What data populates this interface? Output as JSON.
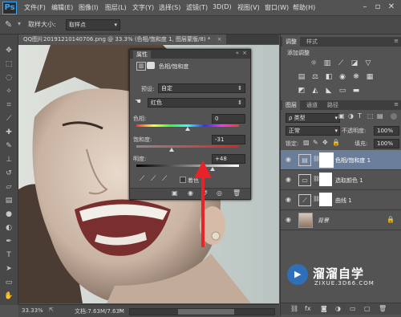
{
  "app": {
    "logo": "Ps"
  },
  "menu": [
    "文件(F)",
    "编辑(E)",
    "图像(I)",
    "图层(L)",
    "文字(Y)",
    "选择(S)",
    "滤镜(T)",
    "3D(D)",
    "视图(V)",
    "窗口(W)",
    "帮助(H)"
  ],
  "options_bar": {
    "sample_size_label": "取样大小:",
    "sample_size_value": "取样点"
  },
  "document": {
    "tab_title": "QQ图片20191210140706.png @ 33.3% (色相/饱和度 1, 图层蒙版/8) *",
    "zoom": "33.33%",
    "doc_info": "文档:7.63M/7.63M"
  },
  "properties": {
    "panel_title": "属性",
    "adjustment_name": "色相/饱和度",
    "preset_label": "预设:",
    "preset_value": "自定",
    "channel_value": "红色",
    "hue_label": "色相:",
    "hue_value": "0",
    "saturation_label": "饱和度:",
    "saturation_value": "-31",
    "lightness_label": "明度:",
    "lightness_value": "+48",
    "colorize_label": "着色",
    "hue_slider": 0.5,
    "saturation_slider": 0.345,
    "lightness_slider": 0.74
  },
  "adjustments_panel": {
    "tabs": [
      "调整",
      "样式"
    ],
    "add_label": "添加调整"
  },
  "layers_panel": {
    "tabs": [
      "图层",
      "通道",
      "路径"
    ],
    "kind_value": "ρ 类型",
    "blend_mode": "正常",
    "opacity_label": "不透明度:",
    "opacity_value": "100%",
    "lock_label": "锁定:",
    "fill_label": "填充:",
    "fill_value": "100%",
    "layers": [
      {
        "name": "色相/饱和度 1",
        "selected": true
      },
      {
        "name": "选取颜色 1",
        "selected": false
      },
      {
        "name": "曲线 1",
        "selected": false
      },
      {
        "name": "背景",
        "selected": false
      }
    ]
  },
  "watermark": {
    "title": "溜溜自学",
    "url": "ZIXUE.3D66.COM"
  },
  "colors": {
    "accent": "#31a8ff",
    "arrow": "#e8242a",
    "selected_layer": "#6a7e99"
  }
}
